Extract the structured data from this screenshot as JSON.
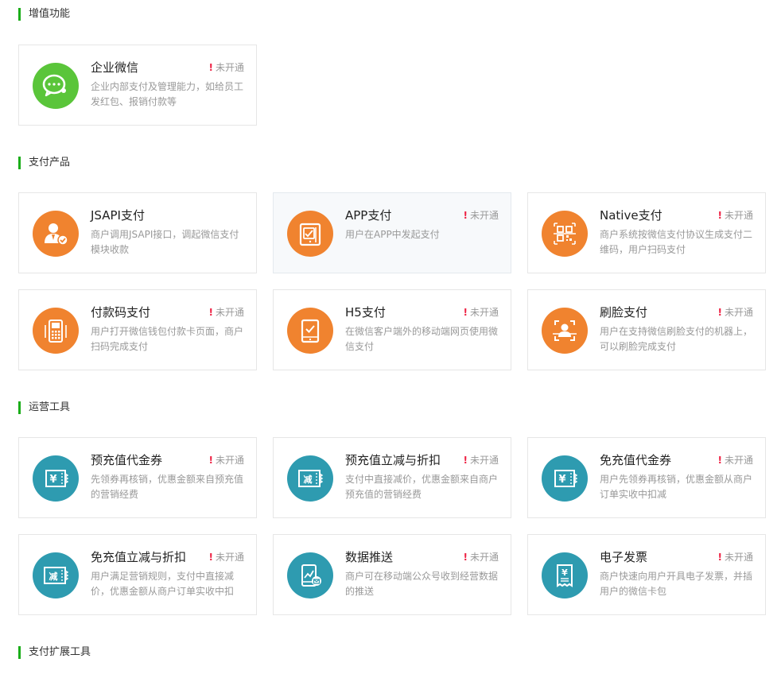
{
  "status_label": "未开通",
  "status_mark": "!",
  "sections": [
    {
      "title": "增值功能",
      "cards": [
        {
          "name": "企业微信",
          "desc": "企业内部支付及管理能力，如给员工发红包、报销付款等",
          "status": "未开通",
          "icon": "wechat-work-icon",
          "color": "#5ac53a"
        }
      ]
    },
    {
      "title": "支付产品",
      "cards": [
        {
          "name": "JSAPI支付",
          "desc": "商户调用JSAPI接口，调起微信支付模块收款",
          "status": "",
          "icon": "user-check-icon",
          "color": "#f0832f"
        },
        {
          "name": "APP支付",
          "desc": "用户在APP中发起支付",
          "status": "未开通",
          "icon": "mobile-app-icon",
          "color": "#f0832f"
        },
        {
          "name": "Native支付",
          "desc": "商户系统按微信支付协议生成支付二维码，用户扫码支付",
          "status": "未开通",
          "icon": "qr-code-icon",
          "color": "#f0832f"
        },
        {
          "name": "付款码支付",
          "desc": "用户打开微信钱包付款卡页面，商户扫码完成支付",
          "status": "未开通",
          "icon": "pos-terminal-icon",
          "color": "#f0832f"
        },
        {
          "name": "H5支付",
          "desc": "在微信客户端外的移动端网页使用微信支付",
          "status": "未开通",
          "icon": "tablet-check-icon",
          "color": "#f0832f"
        },
        {
          "name": "刷脸支付",
          "desc": "用户在支持微信刷脸支付的机器上，可以刷脸完成支付",
          "status": "未开通",
          "icon": "face-scan-icon",
          "color": "#f0832f"
        }
      ]
    },
    {
      "title": "运营工具",
      "cards": [
        {
          "name": "预充值代金券",
          "desc": "先领券再核销，优惠金额来自预充值的营销经费",
          "status": "未开通",
          "icon": "yuan-coupon-icon",
          "color": "#2e9bb0"
        },
        {
          "name": "预充值立减与折扣",
          "desc": "支付中直接减价，优惠金额来自商户预充值的营销经费",
          "status": "未开通",
          "icon": "discount-coupon-icon",
          "color": "#2e9bb0"
        },
        {
          "name": "免充值代金券",
          "desc": "用户先领券再核销，优惠金额从商户订单实收中扣减",
          "status": "未开通",
          "icon": "yuan-coupon-icon",
          "color": "#2e9bb0"
        },
        {
          "name": "免充值立减与折扣",
          "desc": "用户满足营销规则，支付中直接减价，优惠金额从商户订单实收中扣",
          "status": "未开通",
          "icon": "discount-coupon-icon",
          "color": "#2e9bb0"
        },
        {
          "name": "数据推送",
          "desc": "商户可在移动端公众号收到经营数据的推送",
          "status": "未开通",
          "icon": "data-push-icon",
          "color": "#2e9bb0"
        },
        {
          "name": "电子发票",
          "desc": "商户快速向用户开具电子发票，并插用户的微信卡包",
          "status": "未开通",
          "icon": "invoice-icon",
          "color": "#2e9bb0"
        }
      ]
    },
    {
      "title": "支付扩展工具",
      "cards": []
    }
  ],
  "icon_glyphs": {
    "yuan_symbol": "¥",
    "discount_char": "减"
  }
}
